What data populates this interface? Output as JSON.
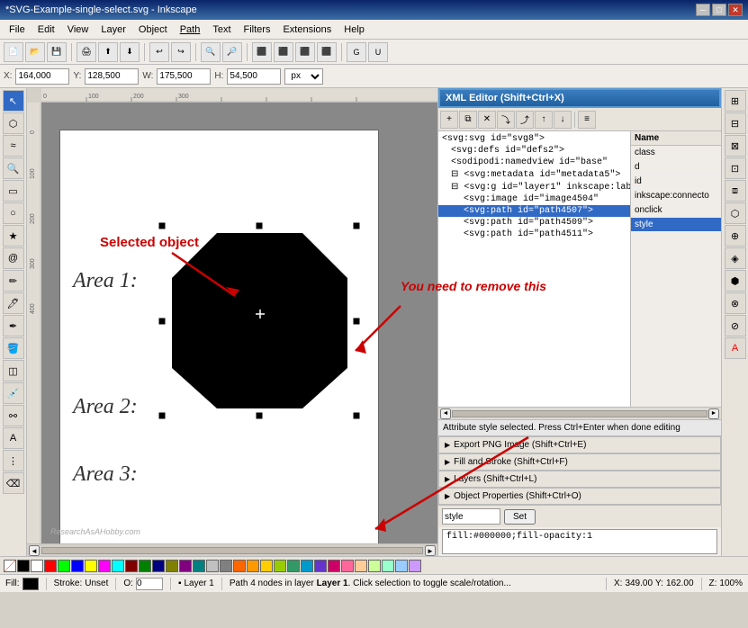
{
  "titlebar": {
    "title": "*SVG-Example-single-select.svg - Inkscape",
    "minimize": "─",
    "maximize": "□",
    "close": "✕"
  },
  "menu": {
    "items": [
      "File",
      "Edit",
      "View",
      "Layer",
      "Object",
      "Path",
      "Text",
      "Filters",
      "Extensions",
      "Help"
    ]
  },
  "coordbar": {
    "x_label": "X:",
    "x_value": "164,000",
    "y_label": "Y:",
    "y_value": "128,500",
    "w_label": "W:",
    "w_value": "175,500",
    "h_label": "H:",
    "h_value": "54,500",
    "unit": "px"
  },
  "xml_editor": {
    "title": "XML Editor (Shift+Ctrl+X)",
    "tree": [
      {
        "indent": 0,
        "text": "<svg:svg id=\"svg8\">",
        "selected": false
      },
      {
        "indent": 1,
        "text": "<svg:defs id=\"defs2\">",
        "selected": false
      },
      {
        "indent": 1,
        "text": "<sodipodi:namedview id=\"base\"",
        "selected": false
      },
      {
        "indent": 1,
        "text": "<svg:metadata id=\"metadata5\">",
        "selected": false
      },
      {
        "indent": 1,
        "text": "<svg:g id=\"layer1\" inkscape:labe",
        "selected": false
      },
      {
        "indent": 2,
        "text": "<svg:image id=\"image4504\"",
        "selected": false
      },
      {
        "indent": 2,
        "text": "<svg:path id=\"path4507\">",
        "selected": true
      },
      {
        "indent": 2,
        "text": "<svg:path id=\"path4509\">",
        "selected": false
      },
      {
        "indent": 2,
        "text": "<svg:path id=\"path4511\">",
        "selected": false
      }
    ],
    "attributes": {
      "header": "Name",
      "items": [
        "class",
        "d",
        "id",
        "inkscape:connecto",
        "onclick",
        "style"
      ]
    },
    "selected_attr": "style",
    "attr_name_value": "style",
    "attr_value": "fill:#000000;fill-opacity:1",
    "set_btn": "Set",
    "status": "Attribute style selected. Press Ctrl+Enter when done editing"
  },
  "panels": [
    {
      "label": "Export PNG Image (Shift+Ctrl+E)"
    },
    {
      "label": "Fill and Stroke (Shift+Ctrl+F)"
    },
    {
      "label": "Layers (Shift+Ctrl+L)"
    },
    {
      "label": "Object Properties (Shift+Ctrl+O)"
    }
  ],
  "canvas": {
    "areas": [
      "Area 1:",
      "Area 2:",
      "Area 3:"
    ],
    "watermark": "ResearchAsAHobby.com",
    "selected_label": "Selected object",
    "remove_label": "You need to remove this"
  },
  "statusbar": {
    "fill_label": "Fill:",
    "fill_value": "",
    "opacity_label": "O:",
    "opacity_value": "0",
    "layer": "Layer 1",
    "status_text": "Path 4 nodes in layer",
    "layer_bold": "Layer 1",
    "status_suffix": ". Click selection to toggle scale/rotation...",
    "x_label": "X:",
    "x_value": "349.00",
    "y_label": "Y:",
    "y_value": "162.00",
    "zoom_label": "Z:",
    "zoom_value": "100%"
  },
  "colors": {
    "accent_blue": "#316ac5",
    "xml_border": "#5b9bd5",
    "annotation_red": "#cc0000",
    "swatch_list": [
      "transparent",
      "#000000",
      "#ffffff",
      "#ff0000",
      "#00ff00",
      "#0000ff",
      "#ffff00",
      "#ff00ff",
      "#00ffff",
      "#800000",
      "#008000",
      "#000080",
      "#808000",
      "#800080",
      "#008080",
      "#c0c0c0",
      "#808080",
      "#ff6600",
      "#ff9900",
      "#ffcc00",
      "#99cc00",
      "#339966",
      "#0099cc",
      "#6633cc",
      "#cc0066",
      "#ff6699",
      "#ffcc99",
      "#ccff99",
      "#99ffcc",
      "#99ccff",
      "#cc99ff"
    ]
  }
}
